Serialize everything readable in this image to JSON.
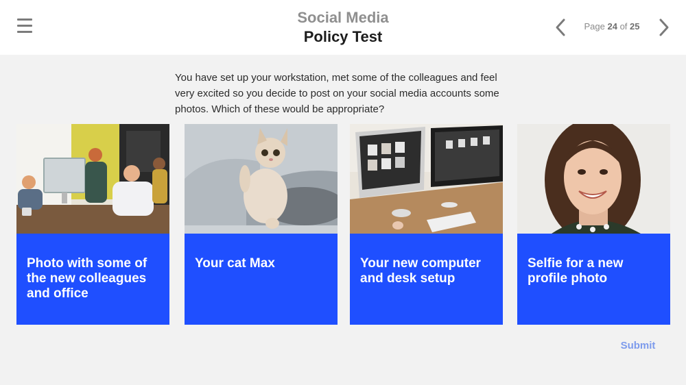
{
  "header": {
    "title_line1": "Social Media",
    "title_line2": "Policy Test",
    "page_word": "Page",
    "page_current": "24",
    "page_of": "of",
    "page_total": "25"
  },
  "question": "You have set up your workstation, met some of the colleagues and feel very excited so you decide to post on your social media accounts some photos. Which of these would be appropriate?",
  "options": [
    {
      "label": "Photo with some of the new colleagues and office",
      "image": "office-colleagues-photo"
    },
    {
      "label": "Your cat Max",
      "image": "kitten-photo"
    },
    {
      "label": "Your new computer and desk setup",
      "image": "desk-setup-photo"
    },
    {
      "label": "Selfie for a new profile photo",
      "image": "selfie-photo"
    }
  ],
  "submit_label": "Submit",
  "colors": {
    "accent": "#1f4fff",
    "submit": "#7d9bec",
    "background": "#f2f2f2"
  }
}
